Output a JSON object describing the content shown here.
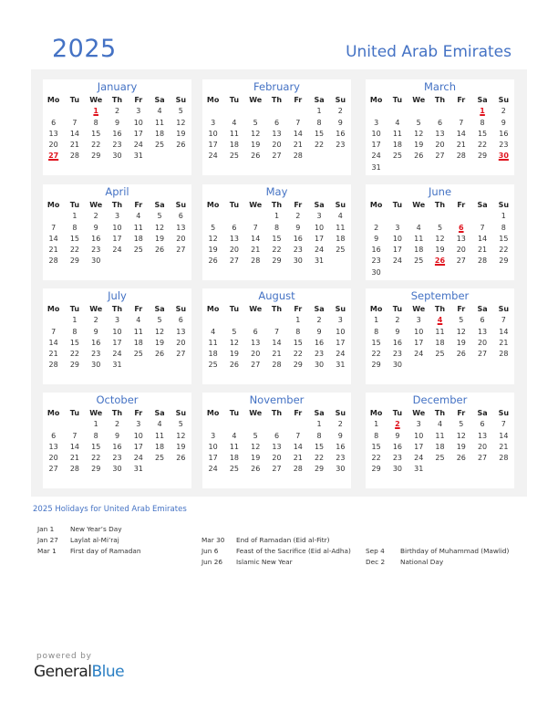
{
  "header": {
    "year": "2025",
    "country": "United Arab Emirates"
  },
  "colors": {
    "accent": "#4472c4",
    "holiday": "#e0141e",
    "panel_bg": "#f2f2f2"
  },
  "weekdays": [
    "Mo",
    "Tu",
    "We",
    "Th",
    "Fr",
    "Sa",
    "Su"
  ],
  "months": [
    {
      "name": "January",
      "offset": 2,
      "days": 31,
      "holidays": [
        1,
        27
      ]
    },
    {
      "name": "February",
      "offset": 5,
      "days": 28,
      "holidays": []
    },
    {
      "name": "March",
      "offset": 5,
      "days": 31,
      "holidays": [
        1,
        30
      ]
    },
    {
      "name": "April",
      "offset": 1,
      "days": 30,
      "holidays": []
    },
    {
      "name": "May",
      "offset": 3,
      "days": 31,
      "holidays": []
    },
    {
      "name": "June",
      "offset": 6,
      "days": 30,
      "holidays": [
        6,
        26
      ]
    },
    {
      "name": "July",
      "offset": 1,
      "days": 31,
      "holidays": []
    },
    {
      "name": "August",
      "offset": 4,
      "days": 31,
      "holidays": []
    },
    {
      "name": "September",
      "offset": 0,
      "days": 30,
      "holidays": [
        4
      ]
    },
    {
      "name": "October",
      "offset": 2,
      "days": 31,
      "holidays": []
    },
    {
      "name": "November",
      "offset": 5,
      "days": 30,
      "holidays": []
    },
    {
      "name": "December",
      "offset": 0,
      "days": 31,
      "holidays": [
        2
      ]
    }
  ],
  "holidays_section": {
    "title": "2025 Holidays for United Arab Emirates",
    "columns": [
      [
        {
          "date": "Jan 1",
          "name": "New Year’s Day"
        },
        {
          "date": "Jan 27",
          "name": "Laylat al-Mi’raj"
        },
        {
          "date": "Mar 1",
          "name": "First day of Ramadan"
        }
      ],
      [
        {
          "date": "Mar 30",
          "name": "End of Ramadan (Eid al-Fitr)"
        },
        {
          "date": "Jun 6",
          "name": "Feast of the Sacrifice (Eid al-Adha)"
        },
        {
          "date": "Jun 26",
          "name": "Islamic New Year"
        }
      ],
      [
        {
          "date": "Sep 4",
          "name": "Birthday of Muhammad (Mawlid)"
        },
        {
          "date": "Dec 2",
          "name": "National Day"
        }
      ]
    ]
  },
  "footer": {
    "powered_by": "powered by",
    "brand_general": "General",
    "brand_blue": "Blue"
  }
}
